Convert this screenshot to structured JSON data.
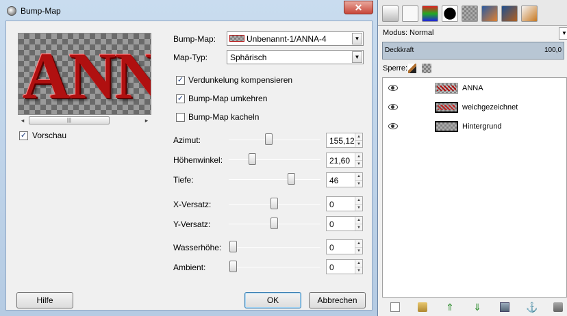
{
  "dialog": {
    "title": "Bump-Map",
    "close_glyph": "✕",
    "preview": {
      "text": "ANN",
      "scroll_left_glyph": "◂",
      "scroll_right_glyph": "▸",
      "scroll_grip": "|||"
    },
    "vorschau": {
      "label": "Vorschau",
      "checked": true
    },
    "bump_map": {
      "label": "Bump-Map:",
      "value": "Unbenannt-1/ANNA-4"
    },
    "map_typ": {
      "label": "Map-Typ:",
      "value": "Sphärisch"
    },
    "checkboxes": [
      {
        "label": "Verdunkelung kompensieren",
        "checked": true
      },
      {
        "label": "Bump-Map umkehren",
        "checked": true
      },
      {
        "label": "Bump-Map kacheln",
        "checked": false
      }
    ],
    "sliders": [
      {
        "label": "Azimut:",
        "value": "155,12",
        "fraction": 0.43
      },
      {
        "label": "Höhenwinkel:",
        "value": "21,60",
        "fraction": 0.24
      },
      {
        "label": "Tiefe:",
        "value": "46",
        "fraction": 0.7
      },
      {
        "label": "X-Versatz:",
        "value": "0",
        "fraction": 0.5
      },
      {
        "label": "Y-Versatz:",
        "value": "0",
        "fraction": 0.5
      },
      {
        "label": "Wasserhöhe:",
        "value": "0",
        "fraction": 0.0
      },
      {
        "label": "Ambient:",
        "value": "0",
        "fraction": 0.0
      }
    ],
    "spin_up_glyph": "▲",
    "spin_down_glyph": "▼",
    "dropdown_glyph": "▼",
    "buttons": {
      "help": "Hilfe",
      "ok": "OK",
      "cancel": "Abbrechen"
    }
  },
  "layers_dock": {
    "mode_label": "Modus:",
    "mode_value": "Normal",
    "opacity_label": "Deckkraft",
    "opacity_value": "100,0",
    "lock_label": "Sperre:",
    "layers": [
      {
        "name": "ANNA",
        "thumb": "anna"
      },
      {
        "name": "weichgezeichnet",
        "thumb": "blur"
      },
      {
        "name": "Hintergrund",
        "thumb": "bg"
      }
    ]
  },
  "colors": {
    "accent_red": "#b01010",
    "titlebar_blue": "#c9dcef",
    "close_red": "#c8473a"
  }
}
